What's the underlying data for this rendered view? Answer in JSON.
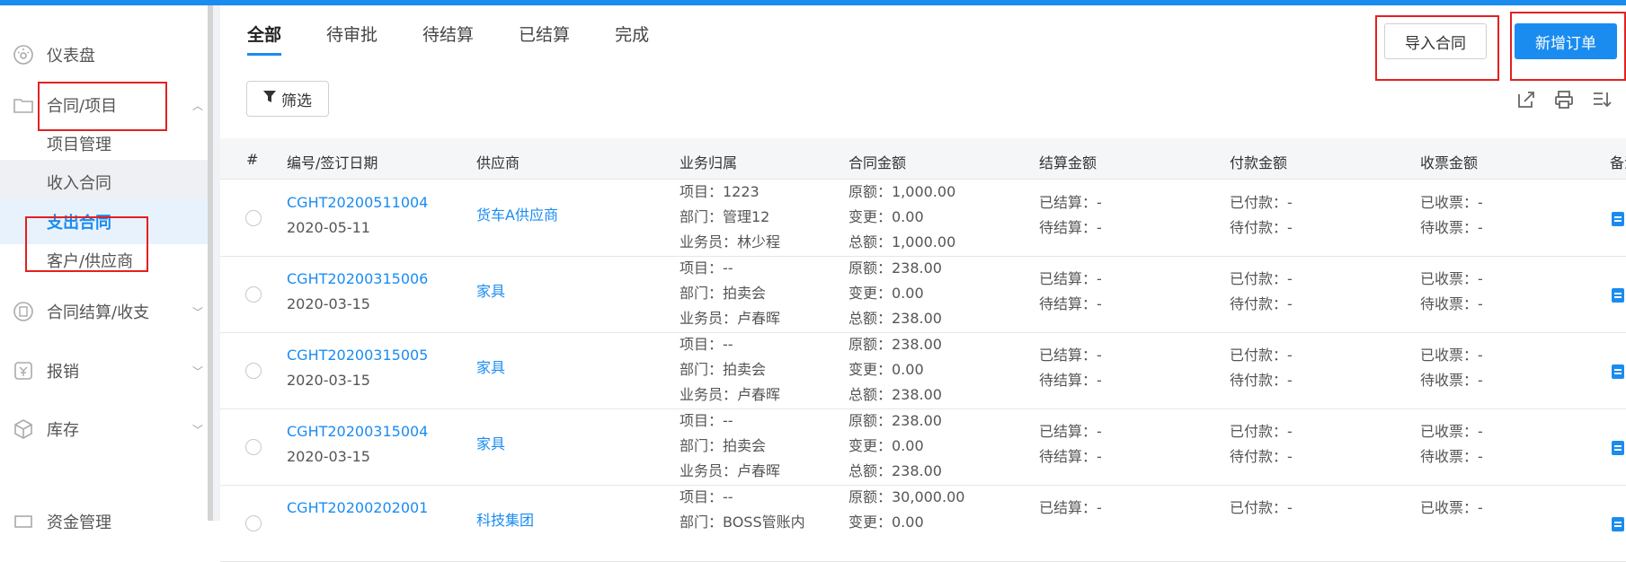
{
  "sidebar": {
    "items": [
      {
        "label": "仪表盘",
        "icon": "dashboard-icon"
      },
      {
        "label": "合同/项目",
        "icon": "folder-icon"
      },
      {
        "label": "合同结算/收支",
        "icon": "settlement-icon"
      },
      {
        "label": "报销",
        "icon": "reimburse-icon"
      },
      {
        "label": "库存",
        "icon": "box-icon"
      },
      {
        "label": "资金管理",
        "icon": "fund-icon"
      }
    ],
    "subitems": [
      {
        "label": "项目管理"
      },
      {
        "label": "收入合同"
      },
      {
        "label": "支出合同"
      },
      {
        "label": "客户/供应商"
      }
    ]
  },
  "tabs": [
    "全部",
    "待审批",
    "待结算",
    "已结算",
    "完成"
  ],
  "buttons": {
    "import": "导入合同",
    "new_order": "新增订单",
    "filter": "筛选"
  },
  "table": {
    "headers": [
      "#",
      "编号/签订日期",
      "供应商",
      "业务归属",
      "合同金额",
      "结算金额",
      "付款金额",
      "收票金额",
      "备注"
    ],
    "rows": [
      {
        "code": "CGHT20200511004",
        "date": "2020-05-11",
        "supplier": "货车A供应商",
        "project": "项目：1223",
        "dept": "部门：管理12",
        "staff": "业务员：林少程",
        "orig": "原额：1,000.00",
        "change": "变更：0.00",
        "total": "总额：1,000.00",
        "settled": "已结算：-",
        "to_settle": "待结算：-",
        "paid": "已付款：-",
        "to_pay": "待付款：-",
        "invoiced": "已收票：-",
        "to_invoice": "待收票：-"
      },
      {
        "code": "CGHT20200315006",
        "date": "2020-03-15",
        "supplier": "家具",
        "project": "项目：--",
        "dept": "部门：拍卖会",
        "staff": "业务员：卢春晖",
        "orig": "原额：238.00",
        "change": "变更：0.00",
        "total": "总额：238.00",
        "settled": "已结算：-",
        "to_settle": "待结算：-",
        "paid": "已付款：-",
        "to_pay": "待付款：-",
        "invoiced": "已收票：-",
        "to_invoice": "待收票：-"
      },
      {
        "code": "CGHT20200315005",
        "date": "2020-03-15",
        "supplier": "家具",
        "project": "项目：--",
        "dept": "部门：拍卖会",
        "staff": "业务员：卢春晖",
        "orig": "原额：238.00",
        "change": "变更：0.00",
        "total": "总额：238.00",
        "settled": "已结算：-",
        "to_settle": "待结算：-",
        "paid": "已付款：-",
        "to_pay": "待付款：-",
        "invoiced": "已收票：-",
        "to_invoice": "待收票：-"
      },
      {
        "code": "CGHT20200315004",
        "date": "2020-03-15",
        "supplier": "家具",
        "project": "项目：--",
        "dept": "部门：拍卖会",
        "staff": "业务员：卢春晖",
        "orig": "原额：238.00",
        "change": "变更：0.00",
        "total": "总额：238.00",
        "settled": "已结算：-",
        "to_settle": "待结算：-",
        "paid": "已付款：-",
        "to_pay": "待付款：-",
        "invoiced": "已收票：-",
        "to_invoice": "待收票：-"
      },
      {
        "code": "CGHT20200202001",
        "date": "",
        "supplier": "科技集团",
        "project": "项目：--",
        "dept": "部门：BOSS管账内",
        "staff": "",
        "orig": "原额：30,000.00",
        "change": "变更：0.00",
        "total": "",
        "settled": "已结算：-",
        "to_settle": "",
        "paid": "已付款：-",
        "to_pay": "",
        "invoiced": "已收票：-",
        "to_invoice": ""
      }
    ]
  },
  "colors": {
    "accent": "#1a8cf0",
    "highlight_box": "#e32020"
  }
}
